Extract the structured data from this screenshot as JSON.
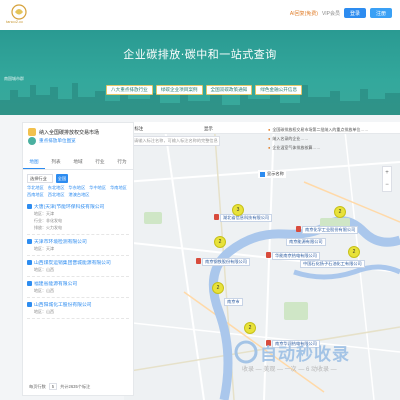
{
  "header": {
    "logo_text": "tanco2.cc",
    "logo_sub": "碳减排",
    "links": [
      "AI回复(免费)",
      "VIP会员"
    ],
    "login_label": "登录",
    "register_label": "注册"
  },
  "hero": {
    "title": "企业碳排放·碳中和一站式查询",
    "city_label": "南国城市群",
    "tabs": [
      "八大重点排放行业",
      "绿碳企业项目案例",
      "全国双碳政策通知",
      "绿色金融公开信息"
    ]
  },
  "panel": {
    "title": "纳入全国碳排放权交易市场",
    "subtitle": "重点排放单位图览",
    "tabs": [
      "地图",
      "列表",
      "地域",
      "行业",
      "行为"
    ],
    "filter_label": "选择行业",
    "filter_button": "全国",
    "regions": [
      "华北地区",
      "东北地区",
      "华东地区",
      "华中地区",
      "华南地区",
      "西南地区",
      "西北地区",
      "港澳台地区"
    ],
    "companies": [
      {
        "name": "大唐(天津)节能环保科技有限公司",
        "meta1": "地区：天津",
        "meta2": "行业：非化发电",
        "meta3": "排放：火力发电"
      },
      {
        "name": "天津市环境检测有限公司",
        "meta1": "地区：天津",
        "meta2": "",
        "meta3": ""
      },
      {
        "name": "山西煤炭运销集团晋城能源有限公司",
        "meta1": "地区：山西",
        "meta2": "",
        "meta3": ""
      },
      {
        "name": "福建省能源有限公司",
        "meta1": "地区：山西",
        "meta2": "",
        "meta3": ""
      },
      {
        "name": "山西阳城化工股份有限公司",
        "meta1": "地区：山西",
        "meta2": "",
        "meta3": ""
      }
    ],
    "pager_label": "每页行数",
    "pager_value": "5",
    "pager_total": "共计2635个标注"
  },
  "map": {
    "search_label": "搜标注",
    "search_label2": "显示",
    "search_placeholder": "请输入标注名称，可输入标注名称的完整信息",
    "legend_label": "显示名称",
    "right_info": [
      "全国碳排放权交易市场第二批纳入的重点排放单位……",
      "纳入名录的企业……",
      "企业温室气体排放核算……"
    ],
    "marker_labels": [
      "湖北省信息科技有限公司",
      "南京化学工业股份有限公司",
      "南京能源有限公司",
      "华能南京热电有限公司",
      "中国石化扬子石油化工有限公司",
      "南京钢铁股份有限公司",
      "南京华润热电有限公司",
      "南京市"
    ],
    "clusters": [
      "2",
      "3",
      "2",
      "2",
      "2",
      "2"
    ]
  },
  "watermark": {
    "title": "自动秒收录",
    "subtitle": "收录 — 美观 — 一次 — 6 动收录 —"
  }
}
